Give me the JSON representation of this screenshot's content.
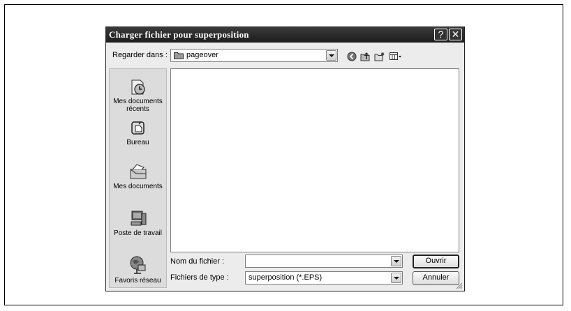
{
  "dialog": {
    "title": "Charger fichier pour superposition",
    "help_label": "?",
    "close_label": "✕"
  },
  "look_in": {
    "label": "Regarder dans :",
    "value": "pageover"
  },
  "toolbar_icons": [
    "back-icon",
    "up-folder-icon",
    "new-folder-icon",
    "view-menu-icon"
  ],
  "places": [
    {
      "label_line1": "Mes documents",
      "label_line2": "récents",
      "icon": "recent-documents-icon"
    },
    {
      "label_line1": "Bureau",
      "label_line2": "",
      "icon": "desktop-icon"
    },
    {
      "label_line1": "Mes documents",
      "label_line2": "",
      "icon": "my-documents-icon"
    },
    {
      "label_line1": "Poste de travail",
      "label_line2": "",
      "icon": "my-computer-icon"
    },
    {
      "label_line1": "Favoris réseau",
      "label_line2": "",
      "icon": "network-places-icon"
    }
  ],
  "filename": {
    "label": "Nom du fichier :",
    "value": ""
  },
  "filetype": {
    "label": "Fichiers de type :",
    "value": "superposition (*.EPS)"
  },
  "buttons": {
    "open": "Ouvrir",
    "cancel": "Annuler"
  }
}
